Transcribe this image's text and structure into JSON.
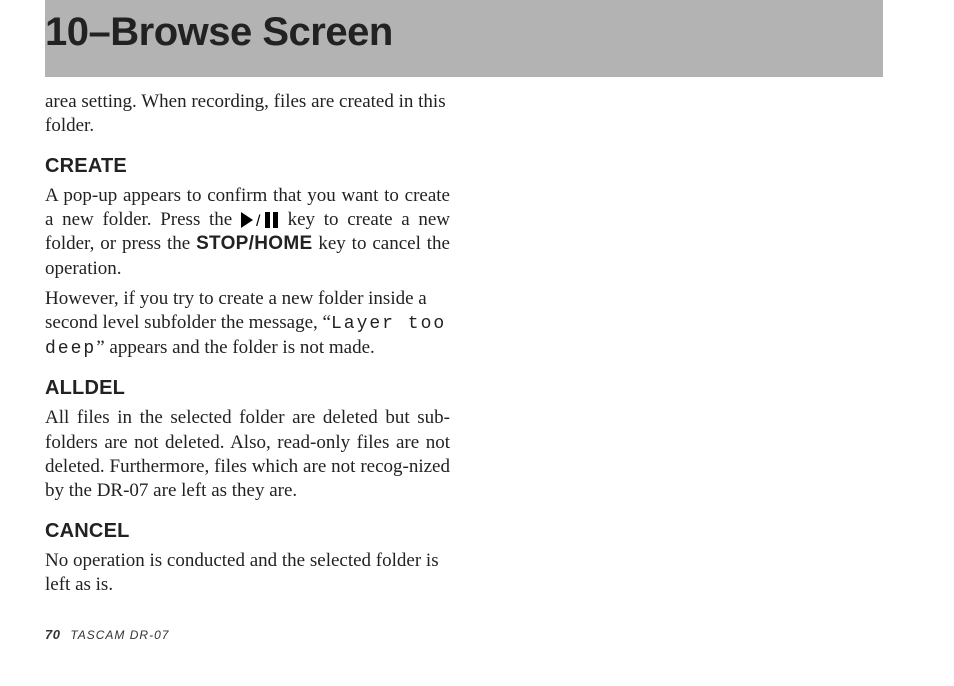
{
  "header": {
    "title": "10–Browse Screen"
  },
  "intro": {
    "text": "area setting. When recording, files are created in this folder."
  },
  "sections": {
    "create": {
      "heading": "CREATE",
      "p1_a": "A pop-up appears to confirm that you want to create a new folder. Press the ",
      "p1_b": " key to create a new folder, or press the ",
      "stophome": "STOP/HOME",
      "p1_c": " key to cancel the operation.",
      "p2_a": "However, if you try to create a new folder inside a second level subfolder the message, “",
      "lcd": "Layer too deep",
      "p2_b": "” appears and the folder is not made."
    },
    "alldel": {
      "heading": "ALLDEL",
      "p1": "All files in the selected folder are deleted but sub-folders are not deleted. Also, read-only files are not deleted. Furthermore, files which are not recog-nized by the DR-07 are left as they are."
    },
    "cancel": {
      "heading": "CANCEL",
      "p1": "No operation is conducted and the selected folder is left as is."
    }
  },
  "footer": {
    "page": "70",
    "model": "TASCAM  DR-07"
  }
}
